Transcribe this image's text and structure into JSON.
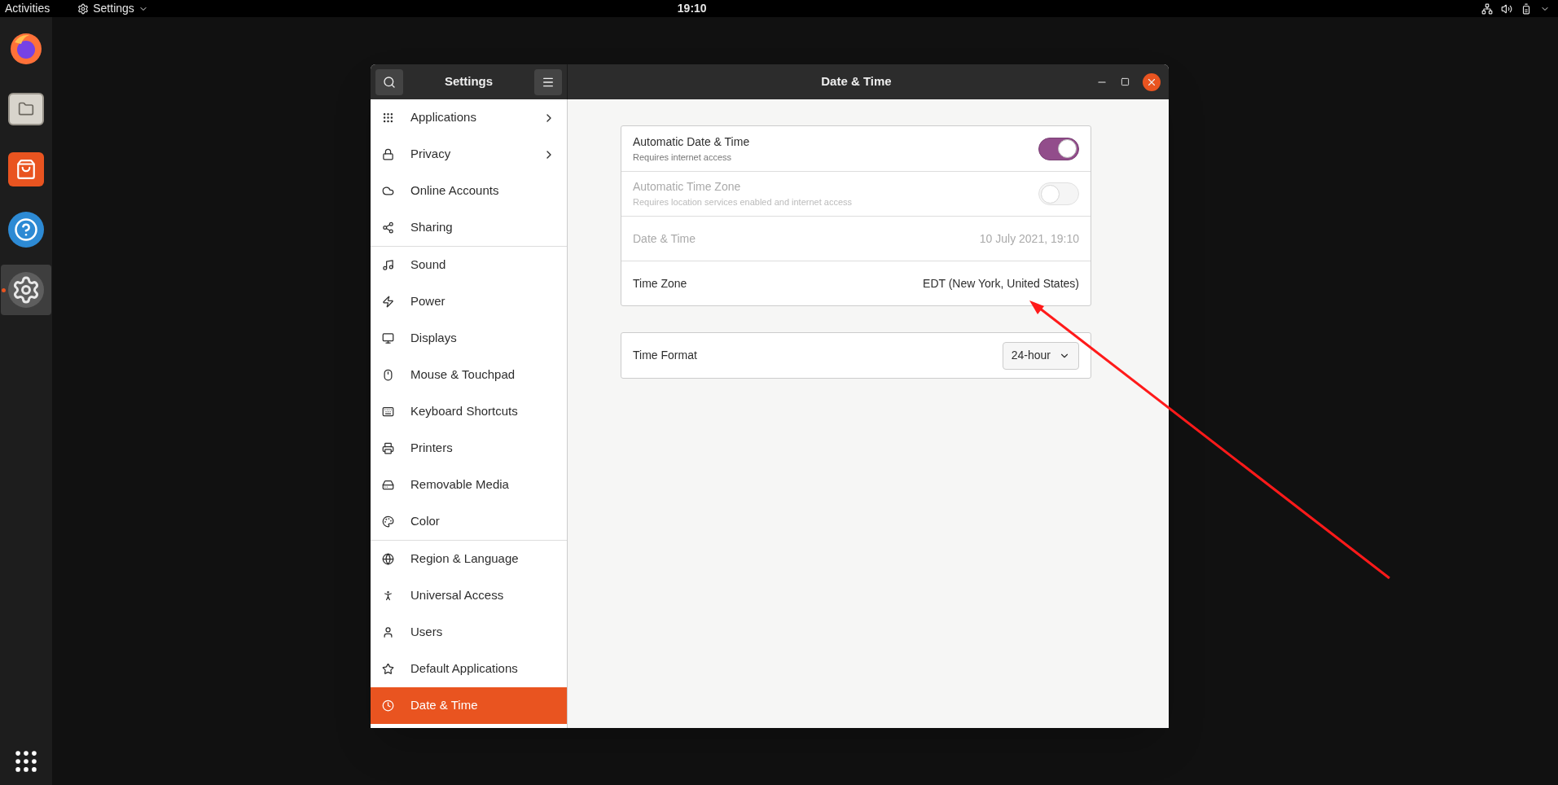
{
  "top_bar": {
    "activities": "Activities",
    "app_menu": "Settings",
    "clock": "19:10"
  },
  "dock": {
    "items": [
      {
        "kind": "browser",
        "selected": false
      },
      {
        "kind": "files",
        "selected": false
      },
      {
        "kind": "software",
        "selected": false
      },
      {
        "kind": "help",
        "selected": false
      },
      {
        "kind": "settings",
        "selected": true
      }
    ]
  },
  "window": {
    "sidebar_title": "Settings",
    "title": "Date & Time",
    "sidebar": {
      "groups": [
        [
          {
            "label": "Applications",
            "arrow": true,
            "selected": false
          },
          {
            "label": "Privacy",
            "arrow": true,
            "selected": false
          },
          {
            "label": "Online Accounts",
            "arrow": false,
            "selected": false
          },
          {
            "label": "Sharing",
            "arrow": false,
            "selected": false
          }
        ],
        [
          {
            "label": "Sound",
            "arrow": false,
            "selected": false
          },
          {
            "label": "Power",
            "arrow": false,
            "selected": false
          },
          {
            "label": "Displays",
            "arrow": false,
            "selected": false
          },
          {
            "label": "Mouse & Touchpad",
            "arrow": false,
            "selected": false
          },
          {
            "label": "Keyboard Shortcuts",
            "arrow": false,
            "selected": false
          },
          {
            "label": "Printers",
            "arrow": false,
            "selected": false
          },
          {
            "label": "Removable Media",
            "arrow": false,
            "selected": false
          },
          {
            "label": "Color",
            "arrow": false,
            "selected": false
          }
        ],
        [
          {
            "label": "Region & Language",
            "arrow": false,
            "selected": false
          },
          {
            "label": "Universal Access",
            "arrow": false,
            "selected": false
          },
          {
            "label": "Users",
            "arrow": false,
            "selected": false
          },
          {
            "label": "Default Applications",
            "arrow": false,
            "selected": false
          },
          {
            "label": "Date & Time",
            "arrow": false,
            "selected": true
          }
        ]
      ]
    },
    "cards": [
      [
        {
          "kind": "switch",
          "label": "Automatic Date & Time",
          "subtitle": "Requires internet access",
          "on": true,
          "disabled": false
        },
        {
          "kind": "switch",
          "label": "Automatic Time Zone",
          "subtitle": "Requires location services enabled and internet access",
          "on": false,
          "disabled": true
        },
        {
          "kind": "value",
          "label": "Date & Time",
          "value": "10 July 2021, 19:10",
          "disabled": true
        },
        {
          "kind": "value",
          "label": "Time Zone",
          "value": "EDT (New York, United States)",
          "disabled": false
        }
      ],
      [
        {
          "kind": "dropdown",
          "label": "Time Format",
          "value": "24-hour",
          "disabled": false
        }
      ]
    ]
  }
}
